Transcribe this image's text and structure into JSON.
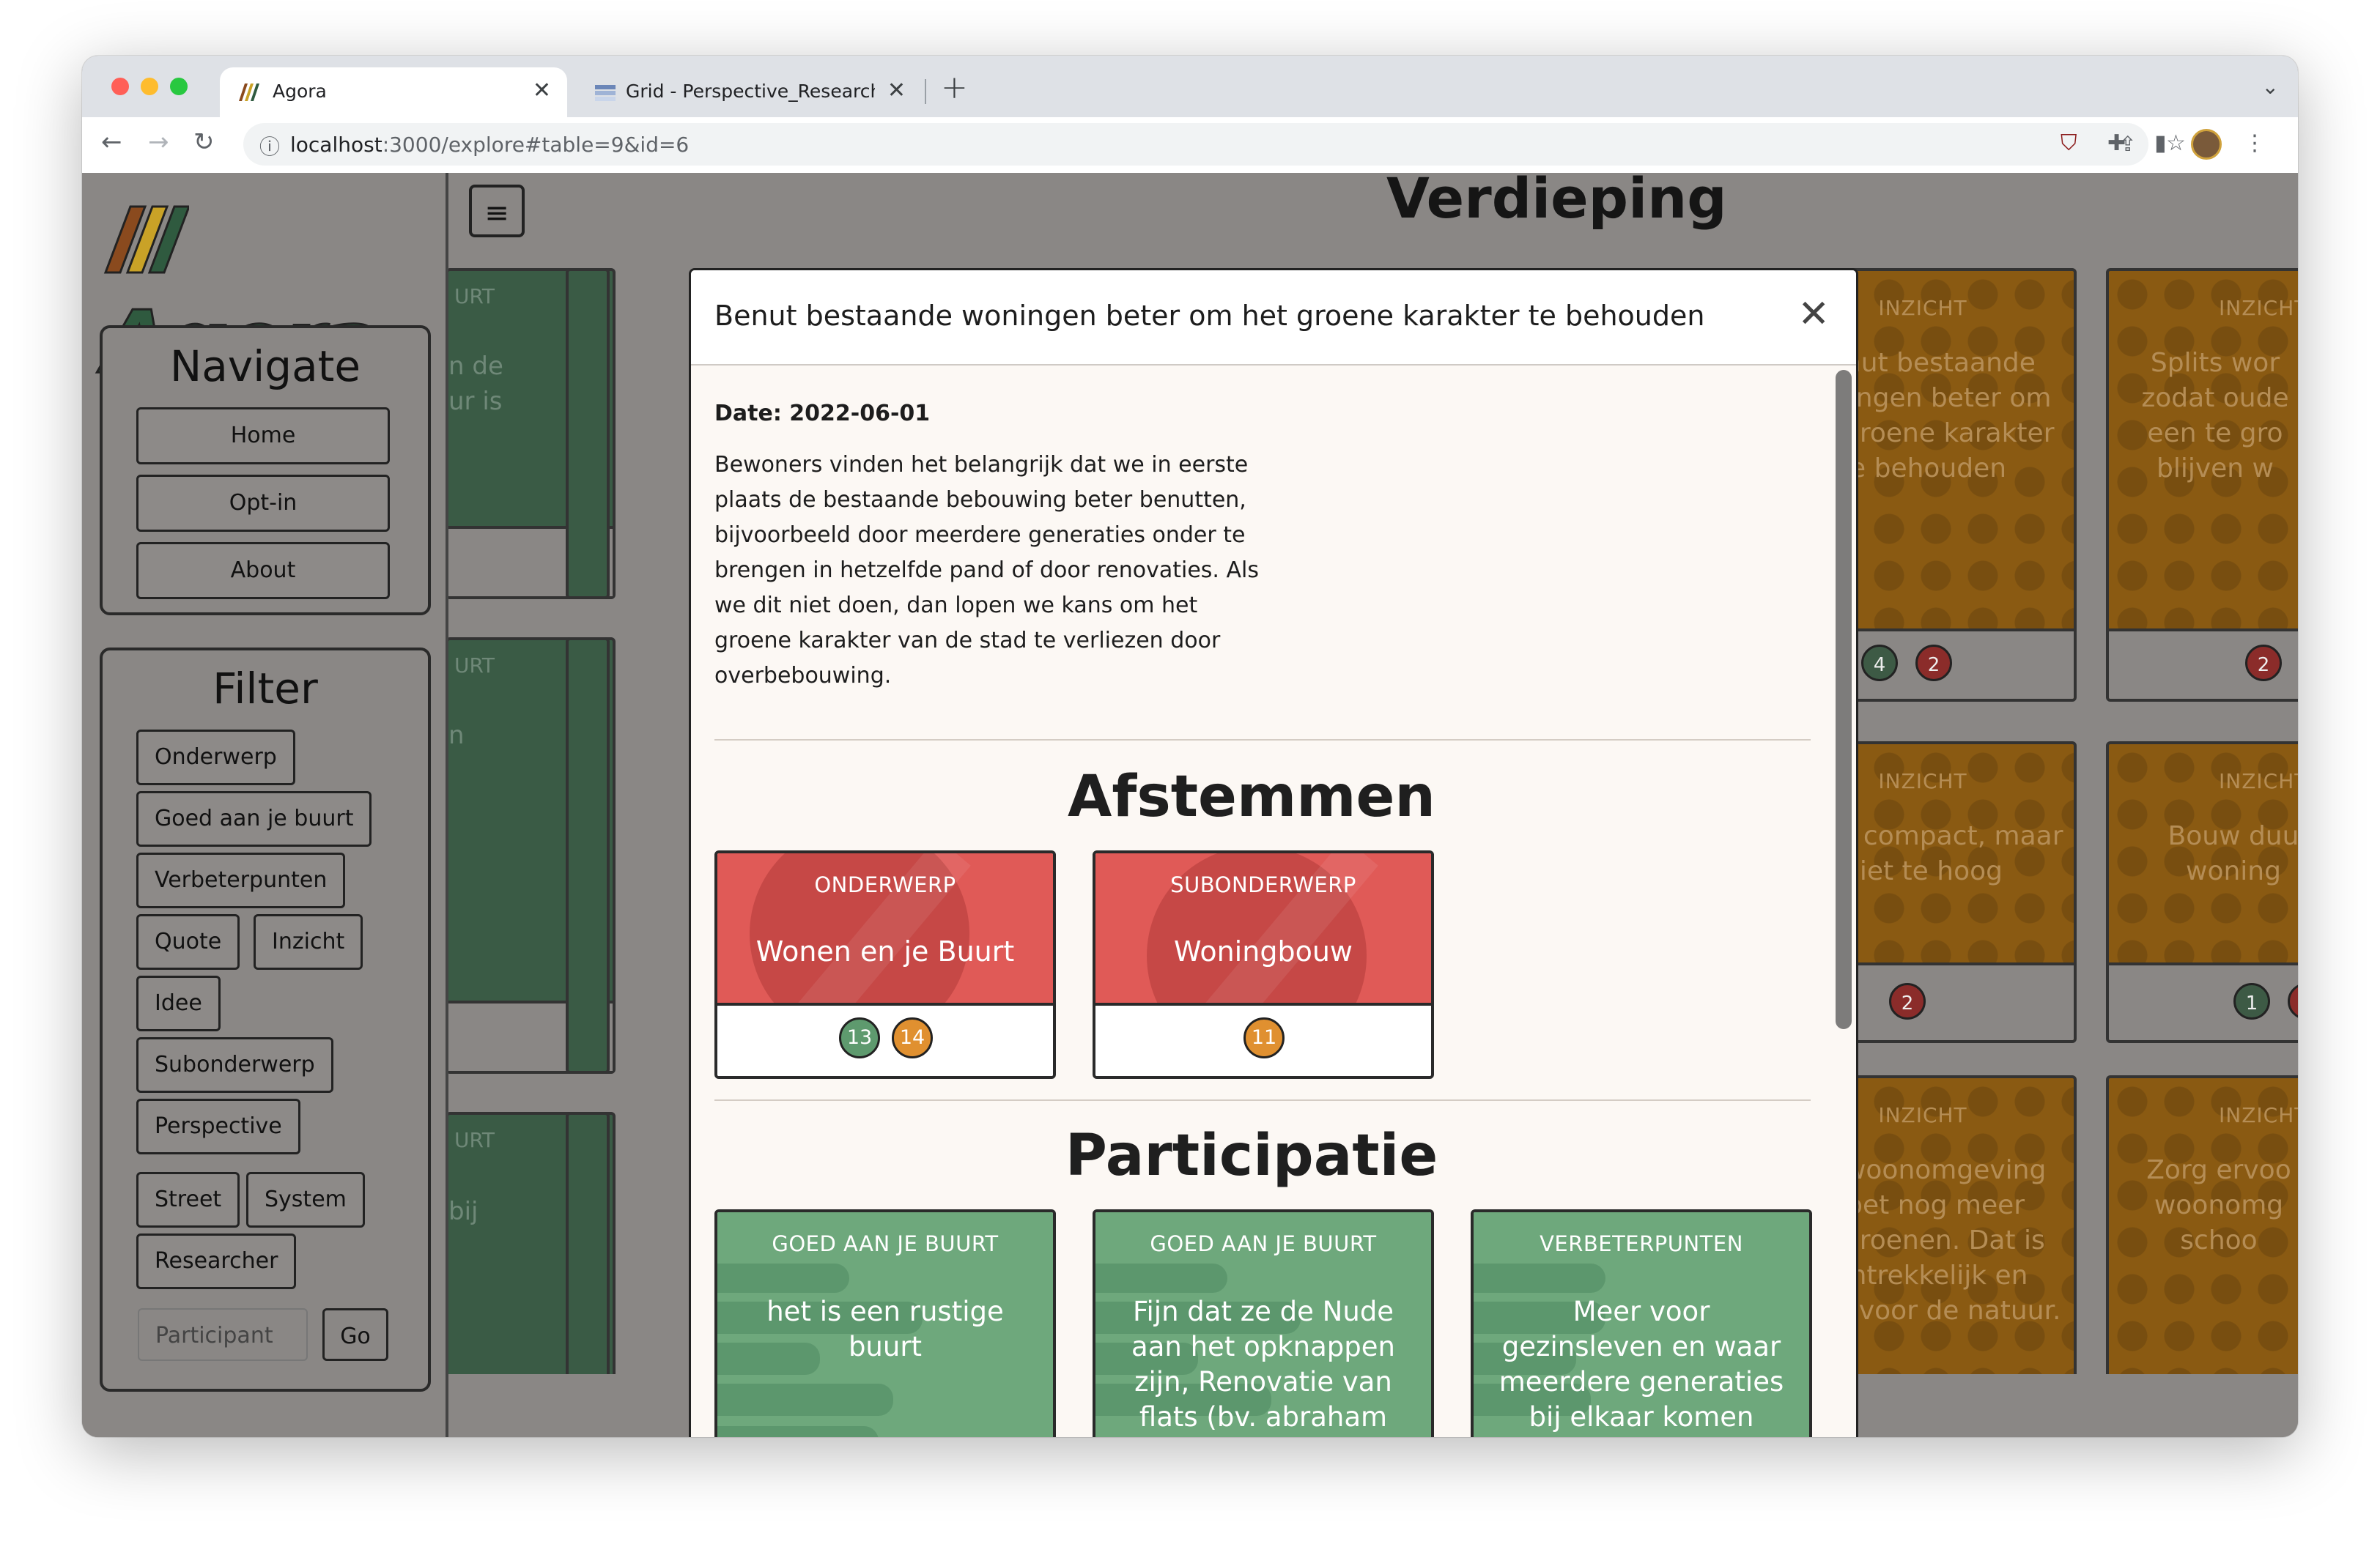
{
  "browser": {
    "tabs": [
      {
        "title": "Agora",
        "active": true
      },
      {
        "title": "Grid - Perspective_Researcher",
        "active": false
      }
    ],
    "url_host": "localhost",
    "url_path": ":3000/explore#table=9&id=6"
  },
  "sidebar": {
    "logo_text": "//Agora",
    "navigate": {
      "title": "Navigate",
      "items": [
        "Home",
        "Opt-in",
        "About"
      ]
    },
    "filter": {
      "title": "Filter",
      "chips": [
        "Onderwerp",
        "Goed aan je buurt",
        "Verbeterpunten",
        "Quote",
        "Inzicht",
        "Idee",
        "Subonderwerp",
        "Perspective",
        "Street",
        "System",
        "Researcher"
      ],
      "participant_placeholder": "Participant",
      "go_label": "Go"
    }
  },
  "background": {
    "section_heading_peek": "Verdieping",
    "green_col_fragments": [
      "URT",
      "n de",
      "ur is",
      "URT",
      "n",
      "URT",
      "bij"
    ],
    "cards": [
      {
        "category": "INZICHT",
        "text": "Benut bestaande woningen beter om het groene karakter te behouden",
        "badges": [
          "4",
          "2"
        ]
      },
      {
        "category": "INZICHT",
        "text": "Splits wor zodat oude een te gro blijven w",
        "badges": [
          "2"
        ]
      },
      {
        "category": "INZICHT",
        "text": "Bouw compact, maar niet te hoog",
        "badges": [
          "2"
        ]
      },
      {
        "category": "INZICHT",
        "text": "Bouw duu woning",
        "badges": [
          "1"
        ]
      },
      {
        "category": "INZICHT",
        "text": "De woonomgeving moet nog meer vergroenen. Dat is aantrekkelijk en goed voor de natuur.",
        "badges": []
      },
      {
        "category": "INZICHT",
        "text": "Zorg ervoo woonomg schoo",
        "badges": []
      }
    ]
  },
  "modal": {
    "title": "Benut bestaande woningen beter om het groene karakter te behouden",
    "date_label": "Date: 2022-06-01",
    "description": "Bewoners vinden het belangrijk dat we in eerste plaats de bestaande bebouwing beter benutten, bijvoorbeeld door meerdere generaties onder te brengen in hetzelfde pand of door renovaties. Als we dit niet doen, dan lopen we kans om het groene karakter van de stad te verliezen door overbebouwing.",
    "sections": [
      {
        "title": "Afstemmen",
        "cards": [
          {
            "category": "ONDERWERP",
            "text": "Wonen en je Buurt",
            "badges": [
              {
                "value": "13",
                "color": "#5e9a6e"
              },
              {
                "value": "14",
                "color": "#e09030"
              }
            ]
          },
          {
            "category": "SUBONDERWERP",
            "text": "Woningbouw",
            "badges": [
              {
                "value": "11",
                "color": "#e09030"
              }
            ]
          }
        ]
      },
      {
        "title": "Participatie",
        "cards": [
          {
            "category": "GOED AAN JE BUURT",
            "text": "het is een rustige buurt"
          },
          {
            "category": "GOED AAN JE BUURT",
            "text": "Fijn dat ze de Nude aan het opknappen zijn, Renovatie van flats (bv. abraham cuyipers straat) en"
          },
          {
            "category": "VERBETERPUNTEN",
            "text": "Meer voor gezinsleven en waar meerdere generaties bij elkaar komen"
          }
        ]
      }
    ]
  },
  "colors": {
    "onderwerp_red": "#e05a57",
    "participatie_green": "#6ea87c",
    "inzicht_orange_dimmed": "#8a5a12",
    "overlay_gray": "#8a8785"
  }
}
